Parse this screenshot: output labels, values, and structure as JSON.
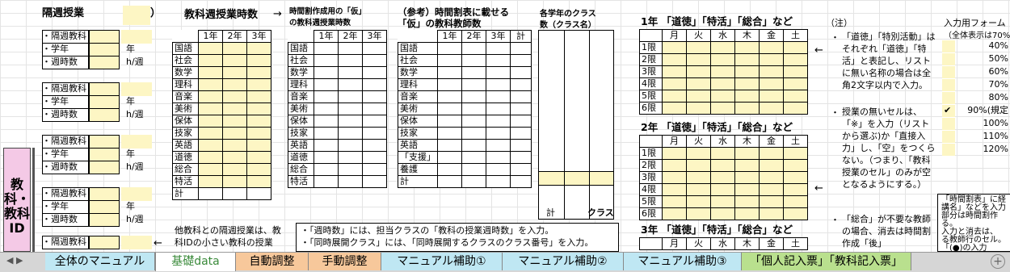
{
  "section_title": "隔週授業",
  "paren_open": "（",
  "paren_close": "）",
  "rows": {
    "subject": "・隔週教科",
    "grade": "・学年",
    "hours": "・週時数"
  },
  "units": {
    "grade": "年",
    "hours": "h/週"
  },
  "vertical_title": "教科・教科ID",
  "weekly_title": "教科週授業時数",
  "grades": [
    "1年",
    "2年",
    "3年"
  ],
  "subjects": [
    "国語",
    "社会",
    "数学",
    "理科",
    "音楽",
    "美術",
    "保体",
    "技家",
    "英語",
    "道徳",
    "総合",
    "特活",
    "計"
  ],
  "kari_title": [
    "時間割作成用の「仮」",
    "の教科週授業時数"
  ],
  "teachers_title": [
    "（参考）時間割表に載せる",
    "「仮」の教科教師数"
  ],
  "teacher_subjects": [
    "国語",
    "社会",
    "数学",
    "理科",
    "音楽",
    "美術",
    "保体",
    "技家",
    "英語",
    "「支援」",
    "養護"
  ],
  "total_label": "計",
  "class_title": [
    "各学年のクラス",
    "数（クラス名）"
  ],
  "class_total": "計",
  "class_label": "クラス",
  "weekday_blocks": [
    {
      "title": "1年 「道徳」「特活」「総合」など"
    },
    {
      "title": "2年 「道徳」「特活」「総合」など"
    },
    {
      "title": "3年 「道徳」「特活」「総合」など"
    }
  ],
  "days": [
    "月",
    "火",
    "水",
    "木",
    "金",
    "土"
  ],
  "periods": [
    "1限",
    "2限",
    "3限",
    "4限",
    "5限",
    "6限"
  ],
  "notes_title": "（注）",
  "notes": [
    "「道徳」「特別活動」はそれぞれ「道徳」「特活」と表記し、リストに無い名称の場合は全角2文字以内で入力。",
    "授業の無いセルは、「※」を入力（リストから選ぶ)か「直接入力」し、「空」をつくらない。（つまり、「教科授業のセル」のみが空となるようにする。）",
    "「総合」が不要な教師の場合、消去は時間割作成「後」"
  ],
  "input_form_title": "入力用フォーム",
  "input_form_sub": "（全体表示は70%",
  "zoom_levels": [
    "40%",
    "50%",
    "60%",
    "70%",
    "80%",
    "90%(規定",
    "100%",
    "110%",
    "120%"
  ],
  "zoom_check": "✔",
  "info_box": [
    "「時間割表」に経",
    "講名」などを入力",
    "部分は時間割作",
    "る。",
    "入力と消去は、",
    "る教師行のセル。",
    "「(●)の入力"
  ],
  "footnote_left": [
    "他教科との隔週授業は、教",
    "科IDの小さい教科の授業"
  ],
  "footnote_main": [
    "・「週時数」には、担当クラスの「教科の授業週時数」を入力。",
    "・「同時展開クラス」には、「同時展開するクラスのクラス番号」を入力。"
  ],
  "tabs": [
    {
      "label": "全体のマニュアル",
      "color": "#bfe7f3"
    },
    {
      "label": "基礎data",
      "color": "#ffffff"
    },
    {
      "label": "自動調整",
      "color": "#f7c89b"
    },
    {
      "label": "手動調整",
      "color": "#f7c89b"
    },
    {
      "label": "マニュアル補助①",
      "color": "#bfe7f3"
    },
    {
      "label": "マニュアル補助②",
      "color": "#bfe7f3"
    },
    {
      "label": "マニュアル補助③",
      "color": "#bfe7f3"
    },
    {
      "label": "「個人記入票」「教科記入票」",
      "color": "#b9e08e"
    }
  ]
}
